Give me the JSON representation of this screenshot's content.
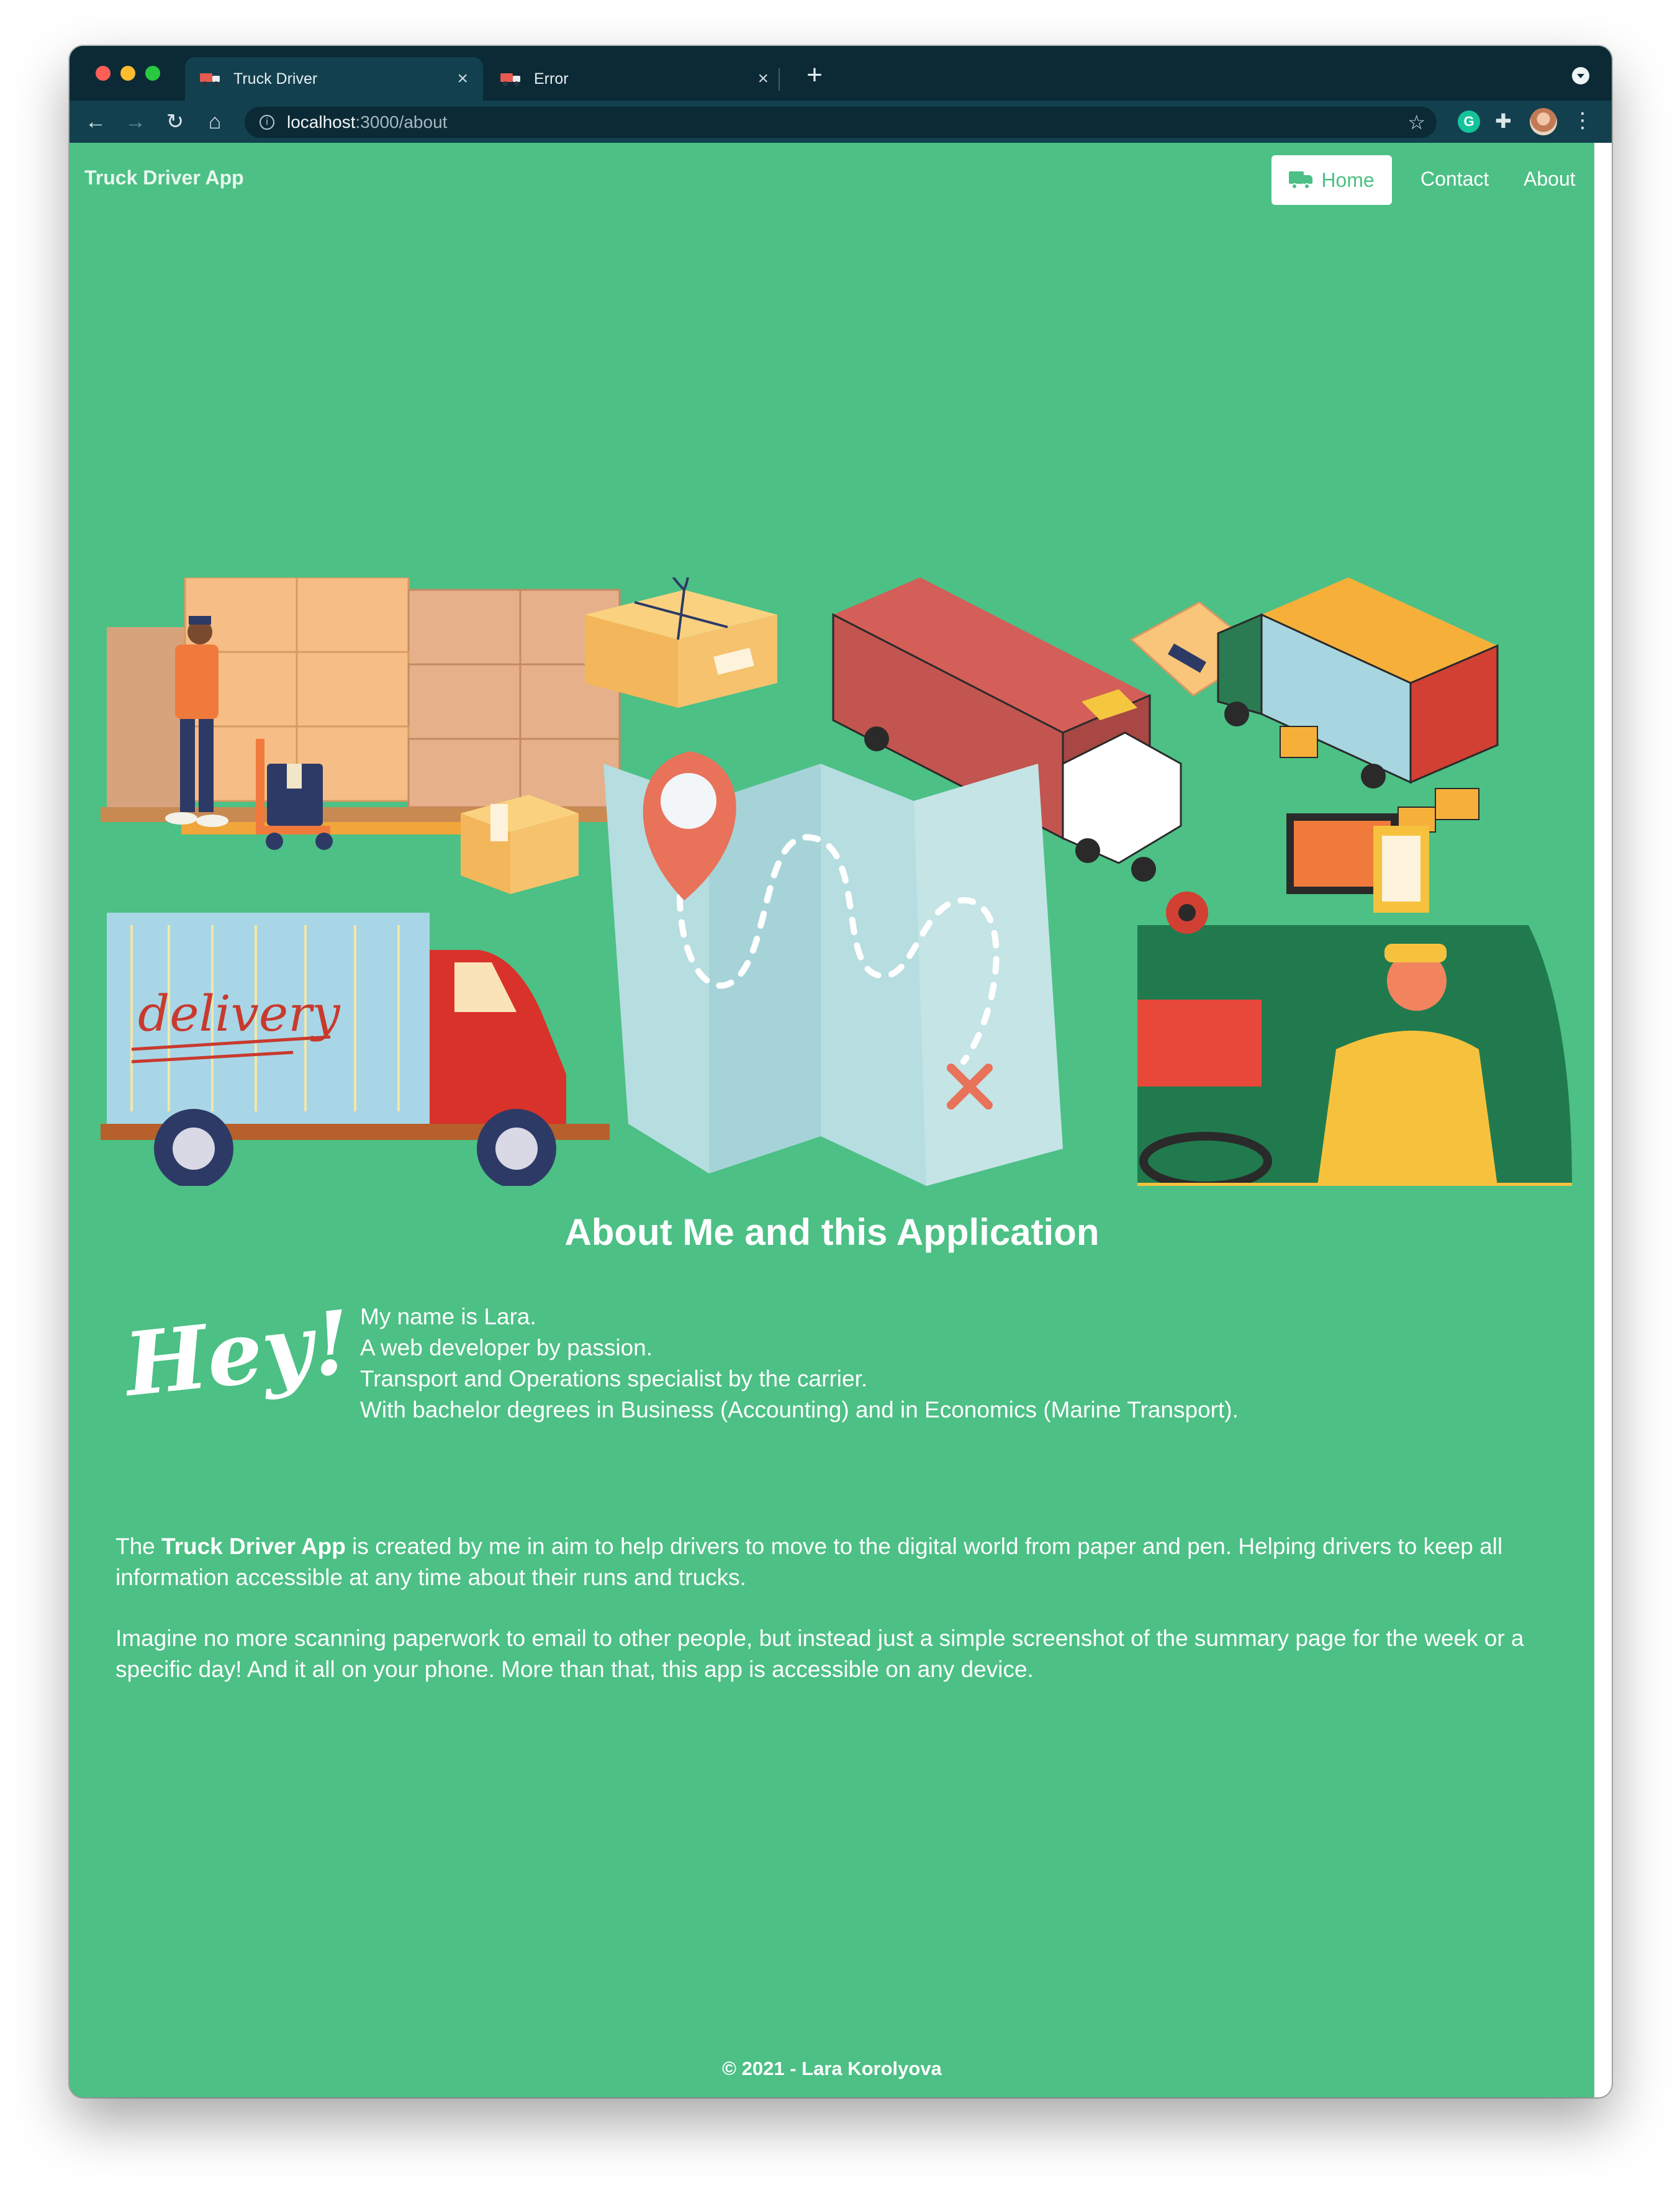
{
  "browser": {
    "tabs": [
      {
        "title": "Truck Driver",
        "close": "×"
      },
      {
        "title": "Error",
        "close": "×"
      }
    ],
    "new_tab": "+",
    "url_host": "localhost",
    "url_path": ":3000/about",
    "extension_label": "G"
  },
  "navbar": {
    "brand": "Truck Driver App",
    "links": [
      {
        "label": "Home",
        "active": true
      },
      {
        "label": "Contact"
      },
      {
        "label": "About"
      }
    ]
  },
  "hero": {
    "illustration_text": "delivery"
  },
  "about": {
    "title": "About Me and this Application",
    "hey": "Hey!",
    "intro": [
      "My name is Lara.",
      "A web developer by passion.",
      "Transport and Operations specialist by the carrier.",
      "With bachelor degrees in Business (Accounting) and in Economics (Marine Transport)."
    ],
    "p1_prefix": "The ",
    "p1_bold": "Truck Driver App",
    "p1_suffix": " is created by me in aim to help drivers to move to the digital world from paper and pen. Helping drivers to keep all information accessible at any time about their runs and trucks.",
    "p2": "Imagine no more scanning paperwork to email to other people, but instead just a simple screenshot of the summary page for the week or a specific day! And it all on your phone. More than that, this app is accessible on any device."
  },
  "footer": {
    "text": "© 2021 - Lara Korolyova"
  },
  "colors": {
    "page_background": "#4cc085",
    "titlebar": "#0b2a36",
    "toolbar": "#12404e"
  }
}
